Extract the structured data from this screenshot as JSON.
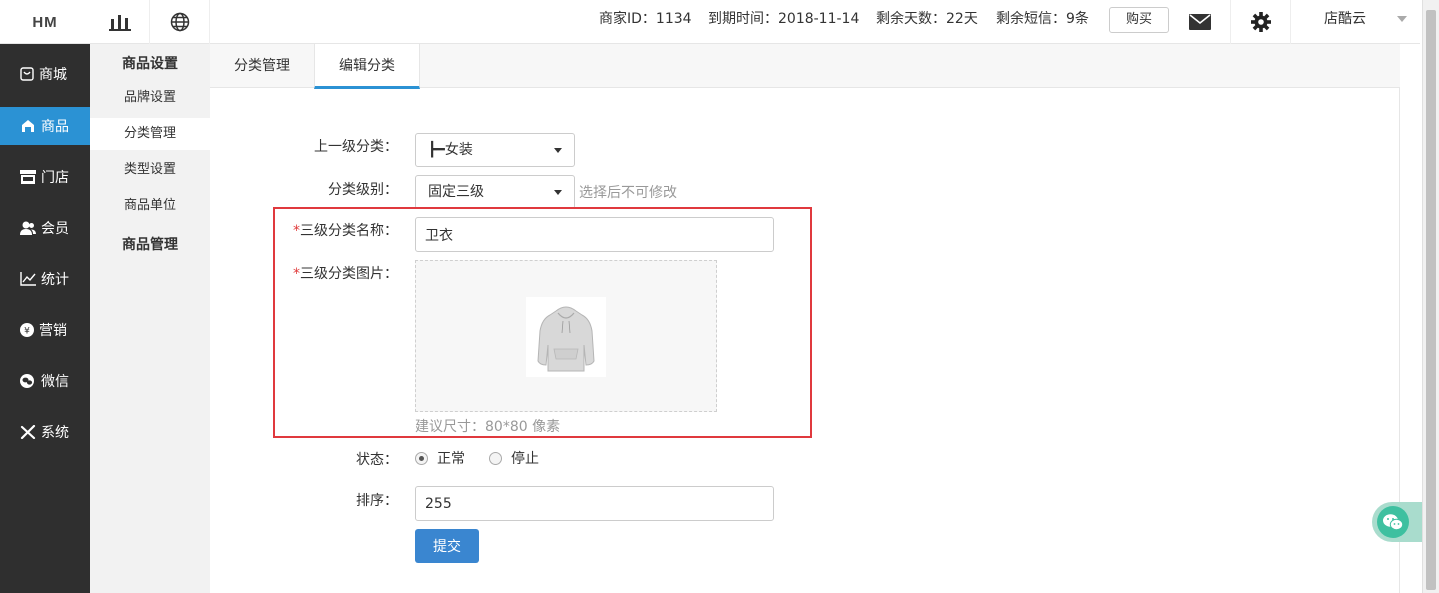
{
  "header": {
    "logo_text": "HM",
    "merchant_id": "商家ID：1134",
    "expire_time": "到期时间：2018-11-14",
    "days_left": "剩余天数：22天",
    "sms_left": "剩余短信：9条",
    "buy_label": "购买",
    "user_name": "店酷云",
    "icons": [
      "bar-chart-icon",
      "globe-icon",
      "mail-icon",
      "gear-icon",
      "caret-down-icon"
    ]
  },
  "sidebar": {
    "accent_color": "#2b92d4",
    "items": [
      {
        "label": "商城",
        "icon": "store-icon"
      },
      {
        "label": "商品",
        "icon": "goods-icon"
      },
      {
        "label": "门店",
        "icon": "shop-icon"
      },
      {
        "label": "会员",
        "icon": "member-icon"
      },
      {
        "label": "统计",
        "icon": "stats-icon"
      },
      {
        "label": "营销",
        "icon": "marketing-icon"
      },
      {
        "label": "微信",
        "icon": "wechat-icon"
      },
      {
        "label": "系统",
        "icon": "system-icon"
      }
    ],
    "active": "商品"
  },
  "subnav": {
    "heading1": "商品设置",
    "items": [
      "品牌设置",
      "分类管理",
      "类型设置",
      "商品单位"
    ],
    "active": "分类管理",
    "heading2": "商品管理"
  },
  "tabs": [
    {
      "label": "分类管理"
    },
    {
      "label": "编辑分类"
    }
  ],
  "active_tab": "编辑分类",
  "form": {
    "parent_label": "上一级分类：",
    "parent_value": "┣━女装",
    "level_label": "分类级别：",
    "level_value": "固定三级",
    "level_hint": "选择后不可修改",
    "required_mark": "*",
    "name_label": "三级分类名称：",
    "name_value": "卫衣",
    "image_label": "三级分类图片：",
    "image_hint": "建议尺寸：80*80 像素",
    "status_label": "状态：",
    "status_options": [
      "正常",
      "停止"
    ],
    "status_selected": "正常",
    "sort_label": "排序：",
    "sort_value": "255",
    "submit_label": "提交"
  }
}
